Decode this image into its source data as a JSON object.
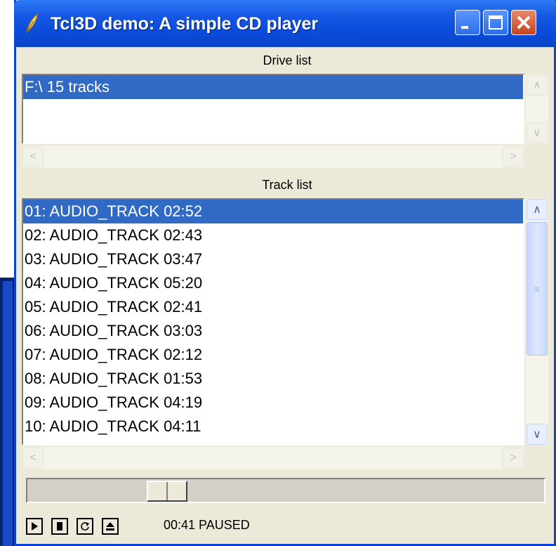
{
  "window": {
    "title": "Tcl3D demo: A simple CD player"
  },
  "drive_list": {
    "label": "Drive list",
    "items": [
      "F:\\ 15 tracks"
    ],
    "selected_index": 0
  },
  "track_list": {
    "label": "Track list",
    "items": [
      "01: AUDIO_TRACK 02:52",
      "02: AUDIO_TRACK 02:43",
      "03: AUDIO_TRACK 03:47",
      "04: AUDIO_TRACK 05:20",
      "05: AUDIO_TRACK 02:41",
      "06: AUDIO_TRACK 03:03",
      "07: AUDIO_TRACK 02:12",
      "08: AUDIO_TRACK 01:53",
      "09: AUDIO_TRACK 04:19",
      "10: AUDIO_TRACK 04:11"
    ],
    "selected_index": 0
  },
  "playback": {
    "position_fraction": 0.25
  },
  "status": {
    "text": "00:41 PAUSED"
  },
  "icons": [
    "app-feather-icon",
    "minimize-icon",
    "maximize-icon",
    "close-icon",
    "play-icon",
    "stop-icon",
    "repeat-icon",
    "eject-icon"
  ],
  "colors": {
    "titlebar": "#0a4bd9",
    "selection": "#316ac5",
    "window_bg": "#ece9d8"
  }
}
